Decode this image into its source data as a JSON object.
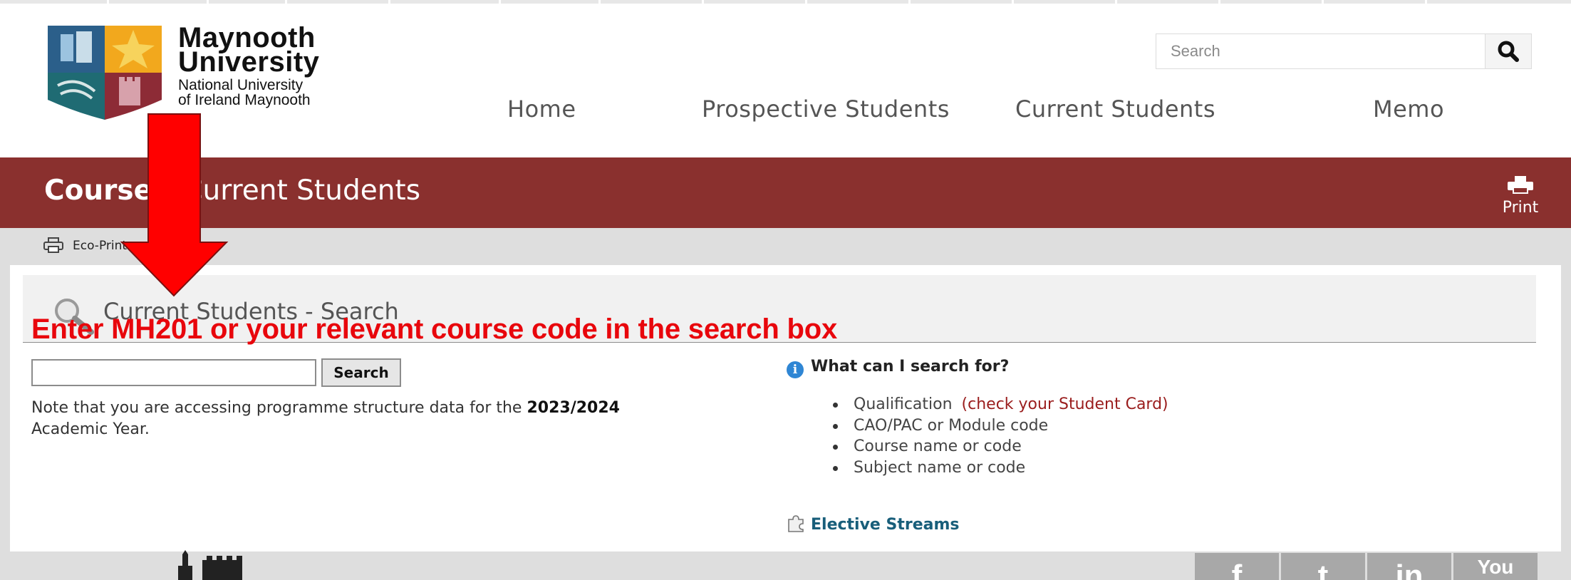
{
  "logo": {
    "line1": "Maynooth",
    "line2": "University",
    "line3": "National University",
    "line4": "of Ireland Maynooth"
  },
  "site_search": {
    "placeholder": "Search",
    "icon": "search-icon"
  },
  "nav": [
    "Home",
    "Prospective Students",
    "Current Students",
    "Memo"
  ],
  "banner": {
    "title_bold": "Courses",
    "title_rest": "Current Students",
    "print_label": "Print"
  },
  "eco_print": "Eco-Print",
  "section_title": "Current Students - Search",
  "annotation": "Enter MH201 or your relevant course code in the search box",
  "course_search": {
    "value": "",
    "button": "Search"
  },
  "note": {
    "prefix": "Note that you are accessing programme structure data for the ",
    "year": "2023/2024",
    "suffix": "Academic Year."
  },
  "help": {
    "heading": "What can I search for?",
    "items": [
      {
        "text": "Qualification ",
        "extra": "(check your Student Card)"
      },
      {
        "text": "CAO/PAC or Module code",
        "extra": ""
      },
      {
        "text": "Course name or code",
        "extra": ""
      },
      {
        "text": "Subject name or code",
        "extra": ""
      }
    ]
  },
  "elective_streams": "Elective Streams",
  "social": [
    "f",
    "t",
    "in",
    "You"
  ],
  "colors": {
    "banner": "#8a302e",
    "annotation": "#e8060c",
    "link": "#185e7a",
    "accent_red": "#9a1d1d"
  }
}
